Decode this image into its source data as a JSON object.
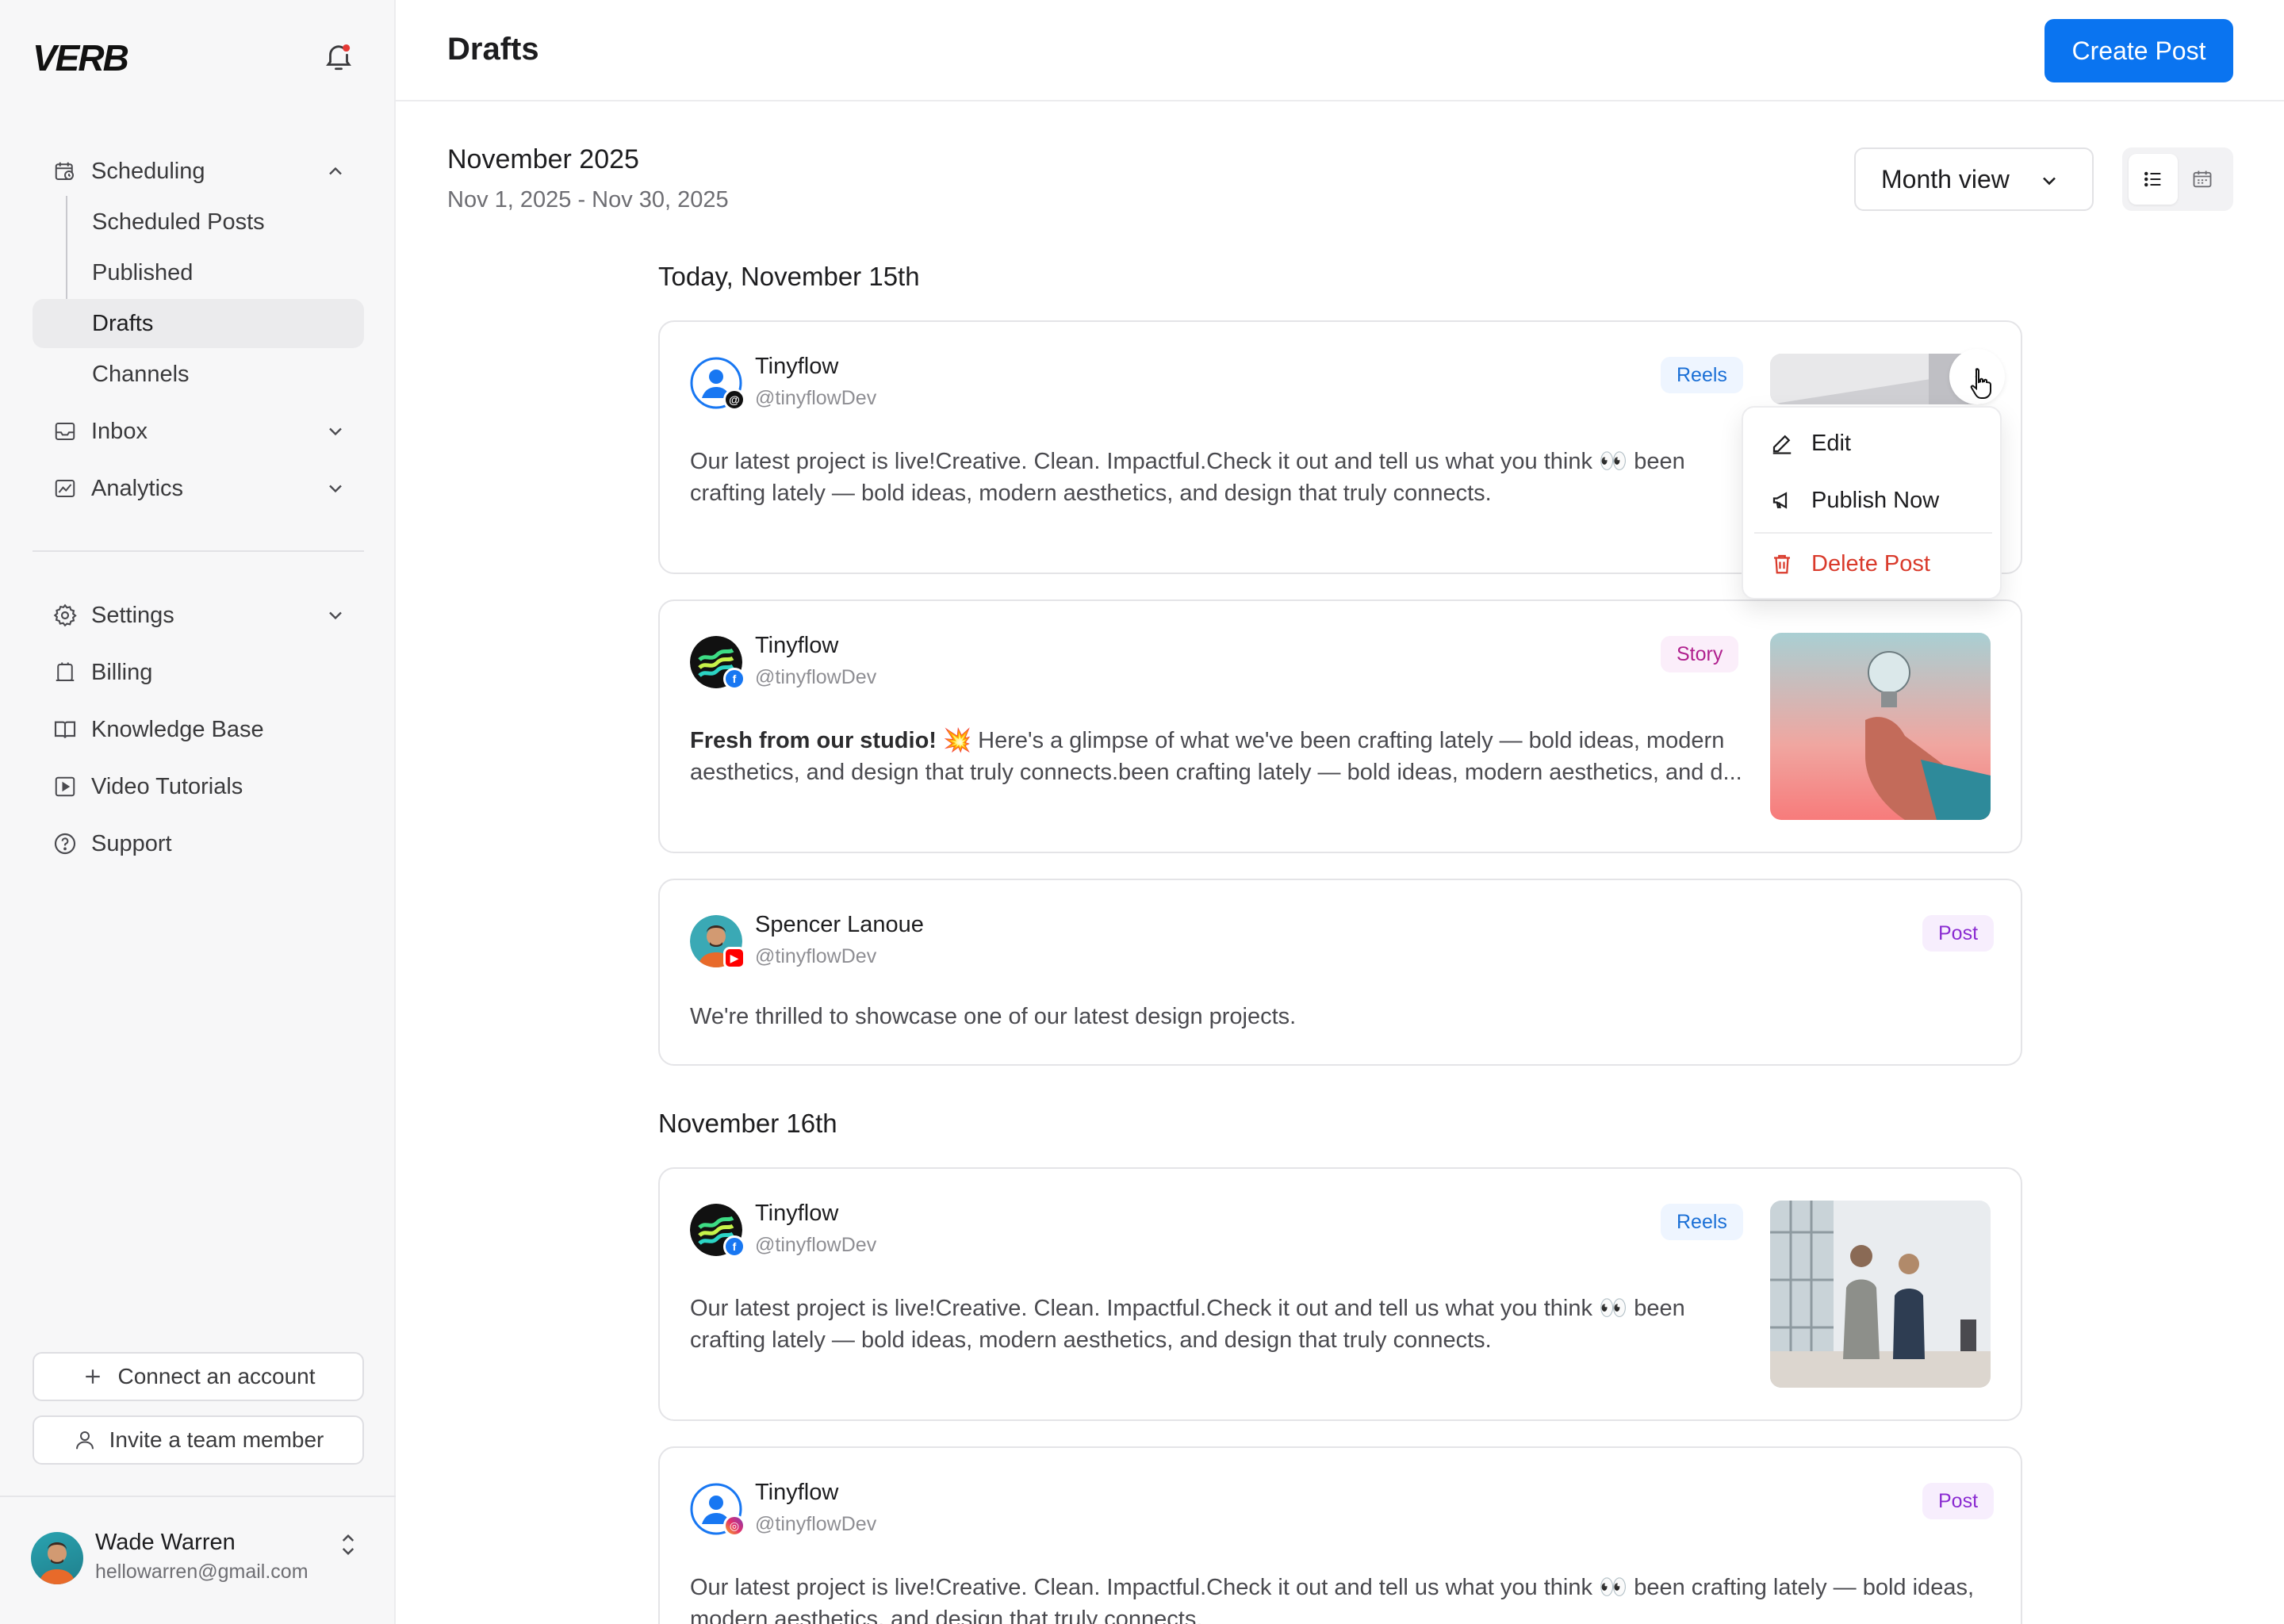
{
  "app": {
    "logo": "VERB"
  },
  "sidebar": {
    "scheduling": {
      "label": "Scheduling",
      "children": [
        "Scheduled Posts",
        "Published",
        "Drafts",
        "Channels"
      ],
      "active": "Drafts"
    },
    "inbox": "Inbox",
    "analytics": "Analytics",
    "settings": "Settings",
    "billing": "Billing",
    "knowledge_base": "Knowledge Base",
    "video_tutorials": "Video Tutorials",
    "support": "Support",
    "connect_account": "Connect an account",
    "invite_member": "Invite a team member"
  },
  "user": {
    "name": "Wade Warren",
    "email": "hellowarren@gmail.com"
  },
  "header": {
    "title": "Drafts",
    "create_button": "Create Post"
  },
  "period": {
    "title": "November 2025",
    "range": "Nov 1, 2025 - Nov 30, 2025",
    "view_select": "Month view"
  },
  "days": [
    {
      "label": "Today, November 15th"
    },
    {
      "label": "November 16th"
    }
  ],
  "posts": [
    {
      "name": "Tinyflow",
      "handle": "@tinyflowDev",
      "badge": "Reels",
      "network": "threads",
      "text": "Our latest project is live!Creative. Clean. Impactful.Check it out and tell us what you think 👀 been crafting lately — bold ideas, modern aesthetics, and design that truly connects."
    },
    {
      "name": "Tinyflow",
      "handle": "@tinyflowDev",
      "badge": "Story",
      "network": "facebook",
      "text_bold": "Fresh from our studio! 💥",
      "text": " Here's a glimpse of what we've been crafting lately — bold ideas, modern aesthetics, and design that truly connects.been crafting lately — bold ideas, modern aesthetics, and d..."
    },
    {
      "name": "Spencer Lanoue",
      "handle": "@tinyflowDev",
      "badge": "Post",
      "network": "youtube",
      "text": "We're thrilled to showcase one of our latest design projects."
    },
    {
      "name": "Tinyflow",
      "handle": "@tinyflowDev",
      "badge": "Reels",
      "network": "facebook",
      "text": "Our latest project is live!Creative. Clean. Impactful.Check it out and tell us what you think 👀 been crafting lately — bold ideas, modern aesthetics, and design that truly connects."
    },
    {
      "name": "Tinyflow",
      "handle": "@tinyflowDev",
      "badge": "Post",
      "network": "instagram",
      "text": "Our latest project is live!Creative. Clean. Impactful.Check it out and tell us what you think 👀 been crafting lately — bold ideas, modern aesthetics, and design that truly connects."
    }
  ],
  "context_menu": {
    "edit": "Edit",
    "publish_now": "Publish Now",
    "delete": "Delete Post"
  },
  "colors": {
    "primary": "#0a74f0",
    "danger": "#d93a2b"
  }
}
